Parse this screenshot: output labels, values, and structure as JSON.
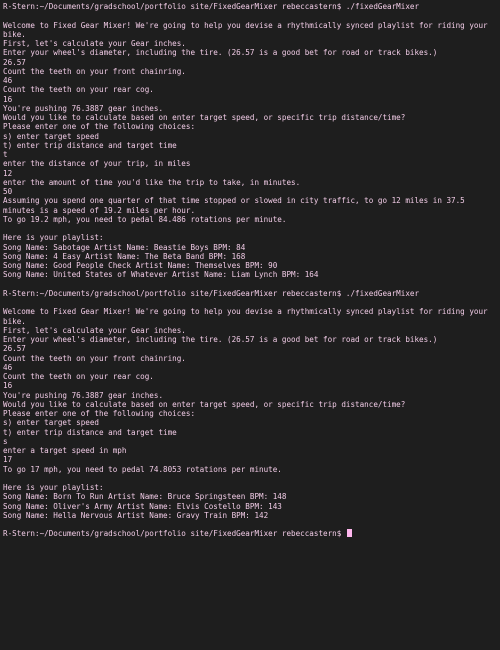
{
  "terminal": {
    "prompt": "R-Stern:~/Documents/gradschool/portfolio site/FixedGearMixer rebeccastern$ ",
    "lines": [
      "R-Stern:~/Documents/gradschool/portfolio site/FixedGearMixer rebeccastern$ ./fixedGearMixer",
      "",
      "Welcome to Fixed Gear Mixer! We're going to help you devise a rhythmically synced playlist for riding your bike.",
      "First, let's calculate your Gear inches.",
      "Enter your wheel's diameter, including the tire. (26.57 is a good bet for road or track bikes.)",
      "26.57",
      "Count the teeth on your front chainring.",
      "46",
      "Count the teeth on your rear cog.",
      "16",
      "You're pushing 76.3887 gear inches.",
      "Would you like to calculate based on enter target speed, or specific trip distance/time?",
      "Please enter one of the following choices:",
      "s) enter target speed",
      "t) enter trip distance and target time",
      "t",
      "enter the distance of your trip, in miles",
      "12",
      "enter the amount of time you'd like the trip to take, in minutes.",
      "50",
      "Assuming you spend one quarter of that time stopped or slowed in city traffic, to go 12 miles in 37.5 minutes is a speed of 19.2 miles per hour.",
      "To go 19.2 mph, you need to pedal 84.486 rotations per minute.",
      "",
      "Here is your playlist:",
      "Song Name: Sabotage Artist Name: Beastie Boys BPM: 84",
      "Song Name: 4 Easy Artist Name: The Beta Band BPM: 168",
      "Song Name: Good People Check Artist Name: Themselves BPM: 90",
      "Song Name: United States of Whatever Artist Name: Liam Lynch BPM: 164",
      "",
      "R-Stern:~/Documents/gradschool/portfolio site/FixedGearMixer rebeccastern$ ./fixedGearMixer",
      "",
      "Welcome to Fixed Gear Mixer! We're going to help you devise a rhythmically synced playlist for riding your bike.",
      "First, let's calculate your Gear inches.",
      "Enter your wheel's diameter, including the tire. (26.57 is a good bet for road or track bikes.)",
      "26.57",
      "Count the teeth on your front chainring.",
      "46",
      "Count the teeth on your rear cog.",
      "16",
      "You're pushing 76.3887 gear inches.",
      "Would you like to calculate based on enter target speed, or specific trip distance/time?",
      "Please enter one of the following choices:",
      "s) enter target speed",
      "t) enter trip distance and target time",
      "s",
      "enter a target speed in mph",
      "17",
      "To go 17 mph, you need to pedal 74.8053 rotations per minute.",
      "",
      "Here is your playlist:",
      "Song Name: Born To Run Artist Name: Bruce Springsteen BPM: 148",
      "Song Name: Oliver's Army Artist Name: Elvis Costello BPM: 143",
      "Song Name: Hella Nervous Artist Name: Gravy Train BPM: 142",
      ""
    ]
  }
}
